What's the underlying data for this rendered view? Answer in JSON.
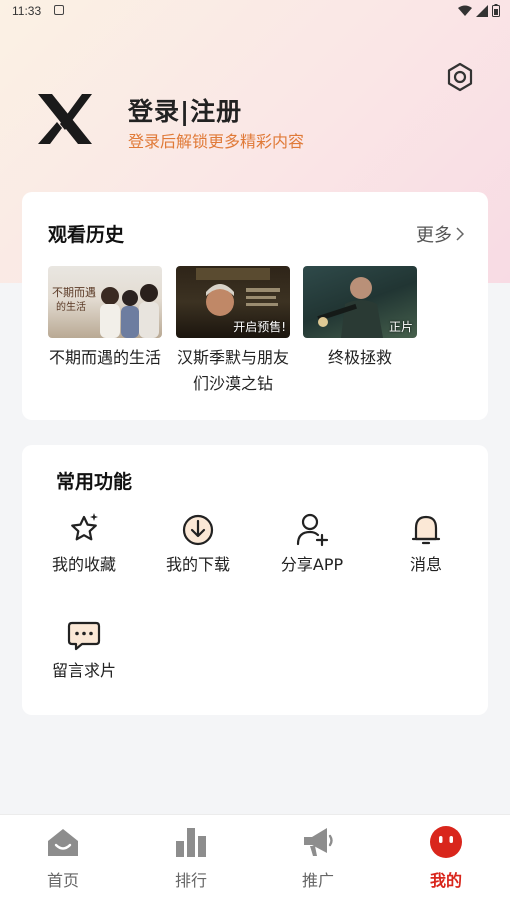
{
  "status_bar": {
    "time": "11:33"
  },
  "profile": {
    "title": "登录|注册",
    "subtitle": "登录后解锁更多精彩内容"
  },
  "history": {
    "title": "观看历史",
    "more_label": "更多",
    "items": [
      {
        "title": "不期而遇的生活",
        "badge": ""
      },
      {
        "title": "汉斯季默与朋友们沙漠之钻",
        "badge": "开启预售!"
      },
      {
        "title": "终极拯救",
        "badge": "正片"
      }
    ]
  },
  "functions": {
    "title": "常用功能",
    "items": [
      {
        "label": "我的收藏",
        "icon": "star-icon"
      },
      {
        "label": "我的下载",
        "icon": "download-icon"
      },
      {
        "label": "分享APP",
        "icon": "add-user-icon"
      },
      {
        "label": "消息",
        "icon": "bell-icon"
      },
      {
        "label": "留言求片",
        "icon": "chat-icon"
      }
    ]
  },
  "tabbar": {
    "active": "我的",
    "accent_color": "#d9261c",
    "tabs": [
      {
        "label": "首页",
        "icon": "home-icon"
      },
      {
        "label": "排行",
        "icon": "bar-chart-icon"
      },
      {
        "label": "推广",
        "icon": "megaphone-icon"
      },
      {
        "label": "我的",
        "icon": "profile-face-icon"
      }
    ]
  }
}
